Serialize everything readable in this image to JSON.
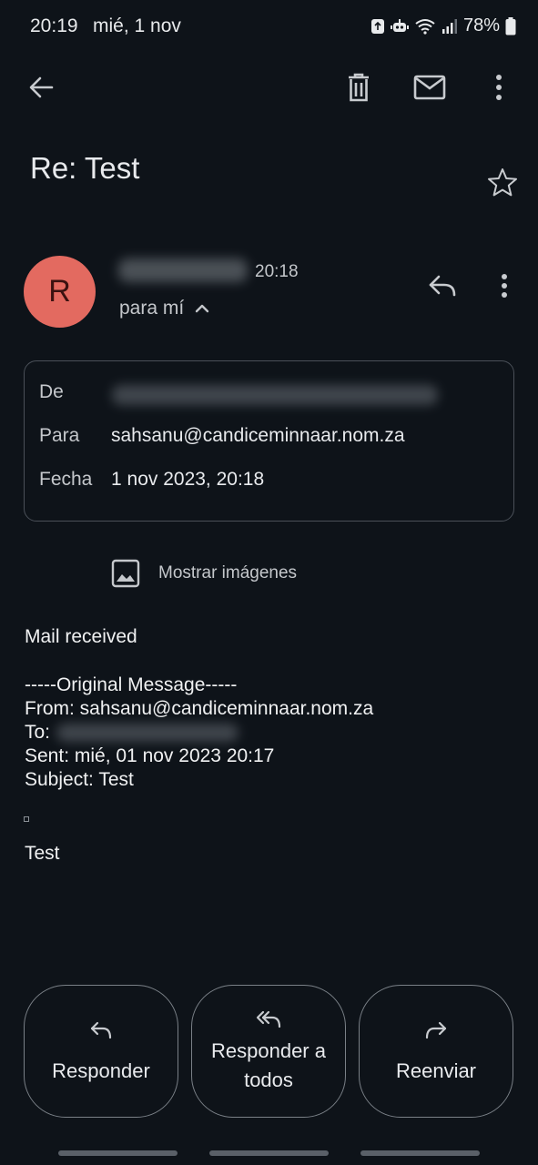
{
  "status_bar": {
    "time": "20:19",
    "date": "mié, 1 nov",
    "battery": "78%"
  },
  "toolbar": {
    "back_icon": "arrow-back-icon",
    "delete_icon": "trash-icon",
    "mark_unread_icon": "mail-icon",
    "more_icon": "more-vert-icon"
  },
  "email": {
    "subject": "Re: Test",
    "sender_initial": "R",
    "time": "20:18",
    "recipient_summary": "para mí"
  },
  "details": {
    "from_label": "De",
    "to_label": "Para",
    "to_value": "sahsanu@candiceminnaar.nom.za",
    "date_label": "Fecha",
    "date_value": "1 nov 2023, 20:18"
  },
  "show_images_label": "Mostrar imágenes",
  "body": {
    "line1": "Mail received",
    "original_header": "-----Original Message-----",
    "from_line": "From: sahsanu@candiceminnaar.nom.za",
    "to_line": "To: ",
    "sent_line": "Sent: mié, 01 nov 2023 20:17",
    "subject_line": "Subject: Test",
    "test_line": "Test"
  },
  "actions": {
    "reply": "Responder",
    "reply_all": "Responder a todos",
    "forward": "Reenviar"
  },
  "colors": {
    "background": "#0e1319",
    "avatar": "#e36a60",
    "border": "#4a5058"
  }
}
